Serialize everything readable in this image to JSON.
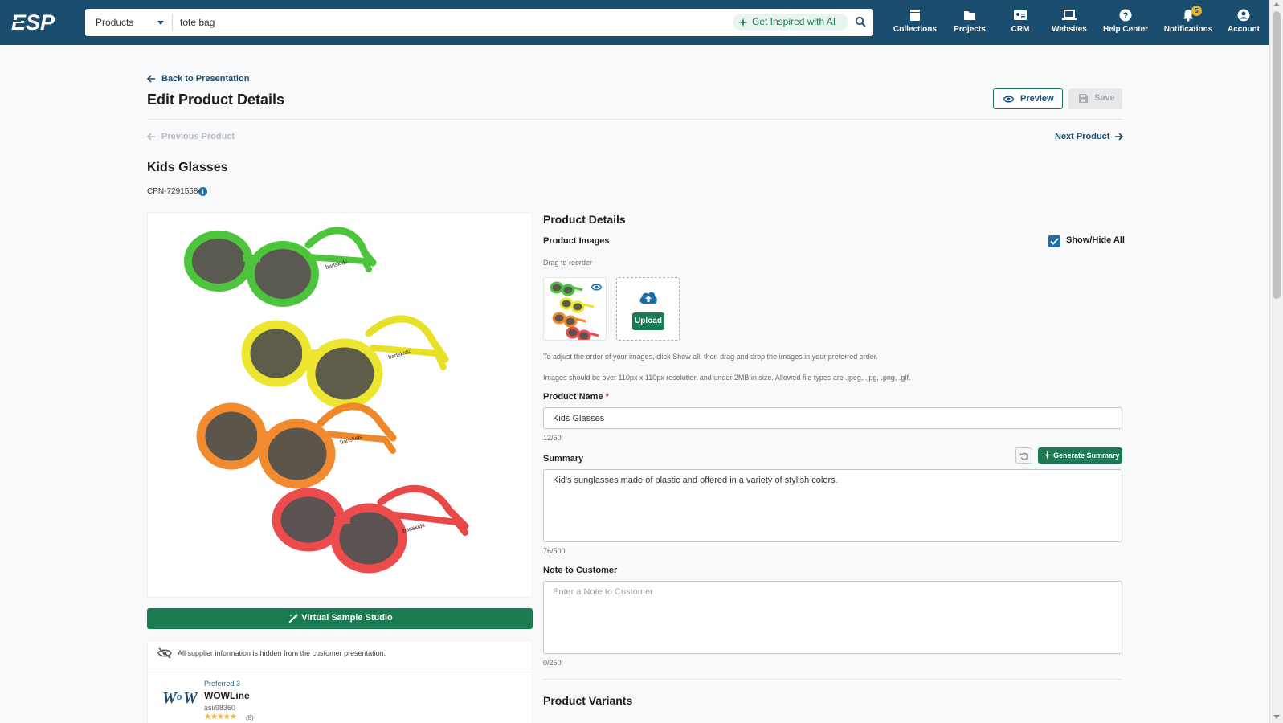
{
  "topbar": {
    "logo_text": "ESP",
    "search_type": "Products",
    "search_value": "tote bag",
    "inspire_label": "Get Inspired with AI",
    "nav": [
      {
        "label": "Collections",
        "icon": "collections-icon"
      },
      {
        "label": "Projects",
        "icon": "folder-icon"
      },
      {
        "label": "CRM",
        "icon": "contact-card-icon"
      },
      {
        "label": "Websites",
        "icon": "laptop-icon"
      },
      {
        "label": "Help Center",
        "icon": "help-icon"
      },
      {
        "label": "Notifications",
        "icon": "bell-icon",
        "badge": "5"
      },
      {
        "label": "Account",
        "icon": "account-icon"
      }
    ]
  },
  "header": {
    "back_label": "Back to Presentation",
    "title": "Edit Product Details",
    "preview_label": "Preview",
    "save_label": "Save",
    "prev_label": "Previous Product",
    "next_label": "Next Product"
  },
  "product": {
    "name": "Kids Glasses",
    "cpn": "CPN-7291558"
  },
  "left": {
    "vss_label": "Virtual Sample Studio",
    "supplier_note": "All supplier information is hidden from the customer presentation.",
    "supplier": {
      "preferred": "Preferred 3",
      "name": "WOWLine",
      "asi": "asi/98360",
      "stars": "★★★★★",
      "rating_count": "(8)"
    }
  },
  "details": {
    "section_title": "Product Details",
    "images_label": "Product Images",
    "show_hide_label": "Show/Hide All",
    "drag_hint": "Drag to reorder",
    "upload_label": "Upload",
    "order_hint": "To adjust the order of your images, click Show all, then drag and drop the images in your preferred order.",
    "size_hint": "Images should be over 110px x 110px resolution and under 2MB in size. Allowed file types are .jpeg, .jpg, .png, .gif.",
    "name_label": "Product Name",
    "name_required": "*",
    "name_value": "Kids Glasses",
    "name_count": "12/60",
    "summary_label": "Summary",
    "generate_label": "Generate Summary",
    "summary_value": "Kid's sunglasses made of plastic and offered in a variety of stylish colors.",
    "summary_count": "76/500",
    "note_label": "Note to Customer",
    "note_placeholder": "Enter a Note to Customer",
    "note_count": "0/250",
    "variants_title": "Product Variants"
  },
  "colors": {
    "brand": "#1b4d6e",
    "accent": "#1a7a52",
    "link_blue": "#1b6fa8",
    "badge": "#f0b429"
  }
}
